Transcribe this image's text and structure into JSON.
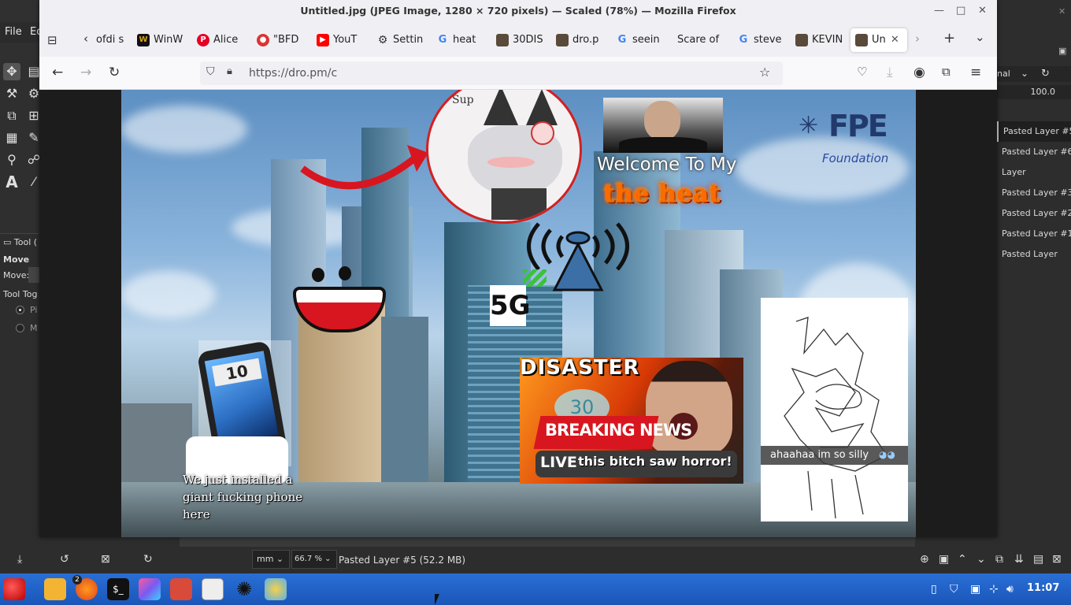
{
  "gimp": {
    "menu": [
      "File",
      "Ed"
    ],
    "tool_options": {
      "header": "Tool (",
      "tool_name": "Move",
      "move_label": "Move:",
      "toggle_label": "Tool Tog",
      "option_1": "Pi",
      "option_2": "M"
    },
    "mode_label": "nal",
    "opacity_value": "100.0",
    "layers": [
      "Pasted Layer #5",
      "Pasted Layer #6",
      "Layer",
      "Pasted Layer #3",
      "Pasted Layer #2",
      "Pasted Layer #1",
      "Pasted Layer"
    ],
    "status": {
      "unit": "mm",
      "zoom": "66.7 %",
      "layer_info": "Pasted Layer #5 (52.2 MB)"
    }
  },
  "firefox": {
    "window_title": "Untitled.jpg (JPEG Image, 1280 × 720 pixels) — Scaled (78%) — Mozilla Firefox",
    "tabs": [
      {
        "label": "ofdi s",
        "icon": "page"
      },
      {
        "label": "WinW",
        "icon": "w-icon"
      },
      {
        "label": "Alice",
        "icon": "pinterest-icon"
      },
      {
        "label": "\"BFD",
        "icon": "bfdi-icon"
      },
      {
        "label": "YouT",
        "icon": "youtube-icon"
      },
      {
        "label": "Settin",
        "icon": "gear-icon"
      },
      {
        "label": "heat",
        "icon": "google-icon"
      },
      {
        "label": "30DIS",
        "icon": "image-icon"
      },
      {
        "label": "dro.p",
        "icon": "image-icon"
      },
      {
        "label": "seein",
        "icon": "google-icon"
      },
      {
        "label": "Scare of",
        "icon": "none"
      },
      {
        "label": "steve",
        "icon": "google-icon"
      },
      {
        "label": "KEVIN",
        "icon": "image-icon"
      },
      {
        "label": "Un",
        "icon": "image-icon",
        "active": true
      }
    ],
    "url": "https://dro.pm/c"
  },
  "image": {
    "welcome_text": "Welcome To My",
    "fire_text": "the heat",
    "fpe_logo": "FPE",
    "fpe_sub": "Foundation",
    "fiveg": "5G",
    "disaster": "DISASTER",
    "breaking": "BREAKING NEWS",
    "live": "LIVE",
    "ticker": "this bitch saw horror!",
    "phone_caption": "We just installed a giant fucking phone here",
    "silly_caption": "ahaahaa im so silly",
    "sup_text": "Sup",
    "phone_time": "10",
    "counter": "30"
  },
  "taskbar": {
    "badge": "2",
    "clock": "11:07"
  }
}
